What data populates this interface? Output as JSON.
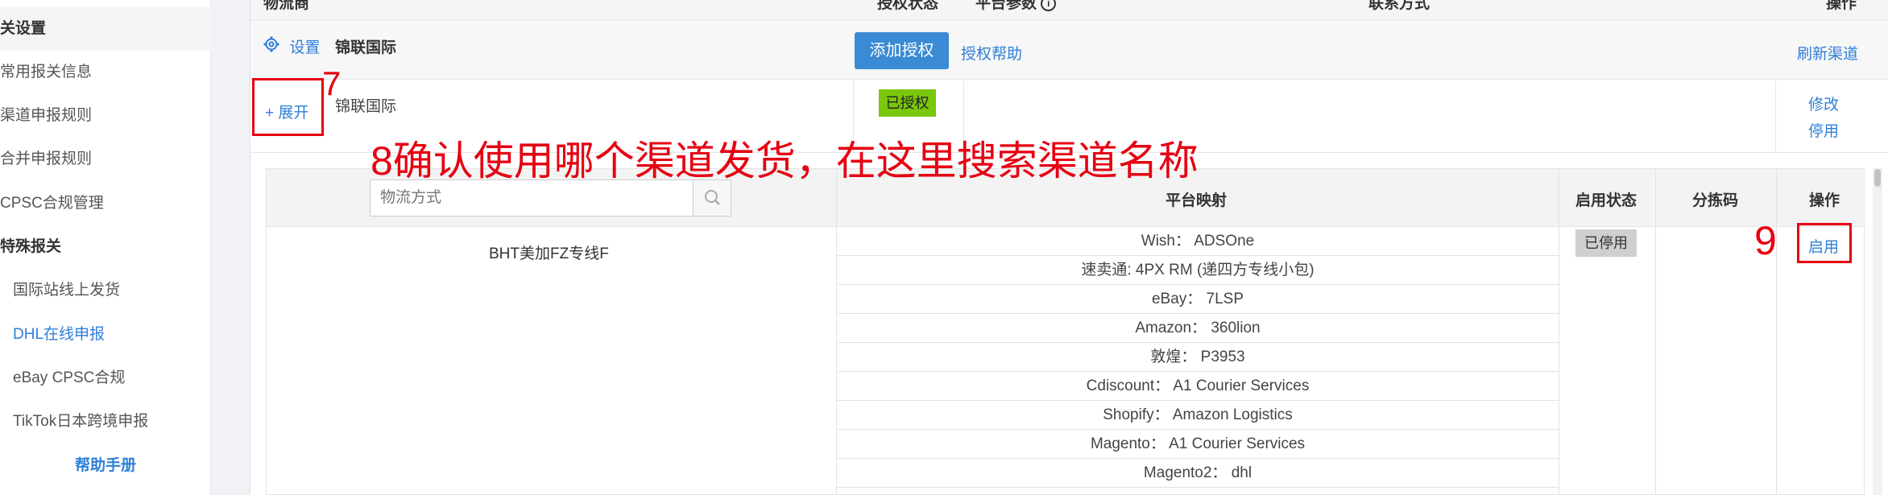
{
  "sidebar": {
    "items": [
      {
        "label": "关设置",
        "kind": "group"
      },
      {
        "label": "常用报关信息",
        "kind": "item"
      },
      {
        "label": "渠道申报规则",
        "kind": "item"
      },
      {
        "label": "合并申报规则",
        "kind": "item"
      },
      {
        "label": "CPSC合规管理",
        "kind": "item"
      },
      {
        "label": "特殊报关",
        "kind": "group"
      },
      {
        "label": "国际站线上发货",
        "kind": "sub"
      },
      {
        "label": "DHL在线申报",
        "kind": "sub-active"
      },
      {
        "label": "eBay CPSC合规",
        "kind": "sub"
      },
      {
        "label": "TikTok日本跨境申报",
        "kind": "sub"
      }
    ],
    "help_label": "帮助手册"
  },
  "table_header": {
    "carrier": "物流商",
    "auth_status": "授权状态",
    "platform_params": "平台参数",
    "contact": "联系方式",
    "actions": "操作"
  },
  "carrier_row": {
    "settings_label": "设置",
    "carrier_name": "锦联国际",
    "add_auth_label": "添加授权",
    "auth_help_label": "授权帮助",
    "refresh_label": "刷新渠道"
  },
  "account_row": {
    "expand_label": "+ 展开",
    "account_name": "锦联国际",
    "status_badge": "已授权",
    "edit_label": "修改",
    "disable_label": "停用"
  },
  "channel_table": {
    "search_placeholder": "物流方式",
    "headers": {
      "mapping": "平台映射",
      "status": "启用状态",
      "sort_code": "分拣码",
      "actions": "操作"
    },
    "row": {
      "channel_name": "BHT美加FZ专线F",
      "status_badge": "已停用",
      "enable_label": "启用",
      "mappings": [
        "Wish： ADSOne",
        "速卖通: 4PX RM (递四方专线小包)",
        "eBay： 7LSP",
        "Amazon： 360lion",
        "敦煌： P3953",
        "Cdiscount： A1 Courier Services",
        "Shopify： Amazon Logistics",
        "Magento： A1 Courier Services",
        "Magento2： dhl"
      ]
    }
  },
  "annotations": {
    "step7": "7",
    "step8": "8确认使用哪个渠道发货，在这里搜索渠道名称",
    "step9": "9"
  },
  "colors": {
    "link": "#2f7ed8",
    "primary_button": "#3a8ad4",
    "authorized_badge": "#7ac70c",
    "disabled_badge": "#cfcfcf",
    "annotation_red": "#e60012"
  }
}
